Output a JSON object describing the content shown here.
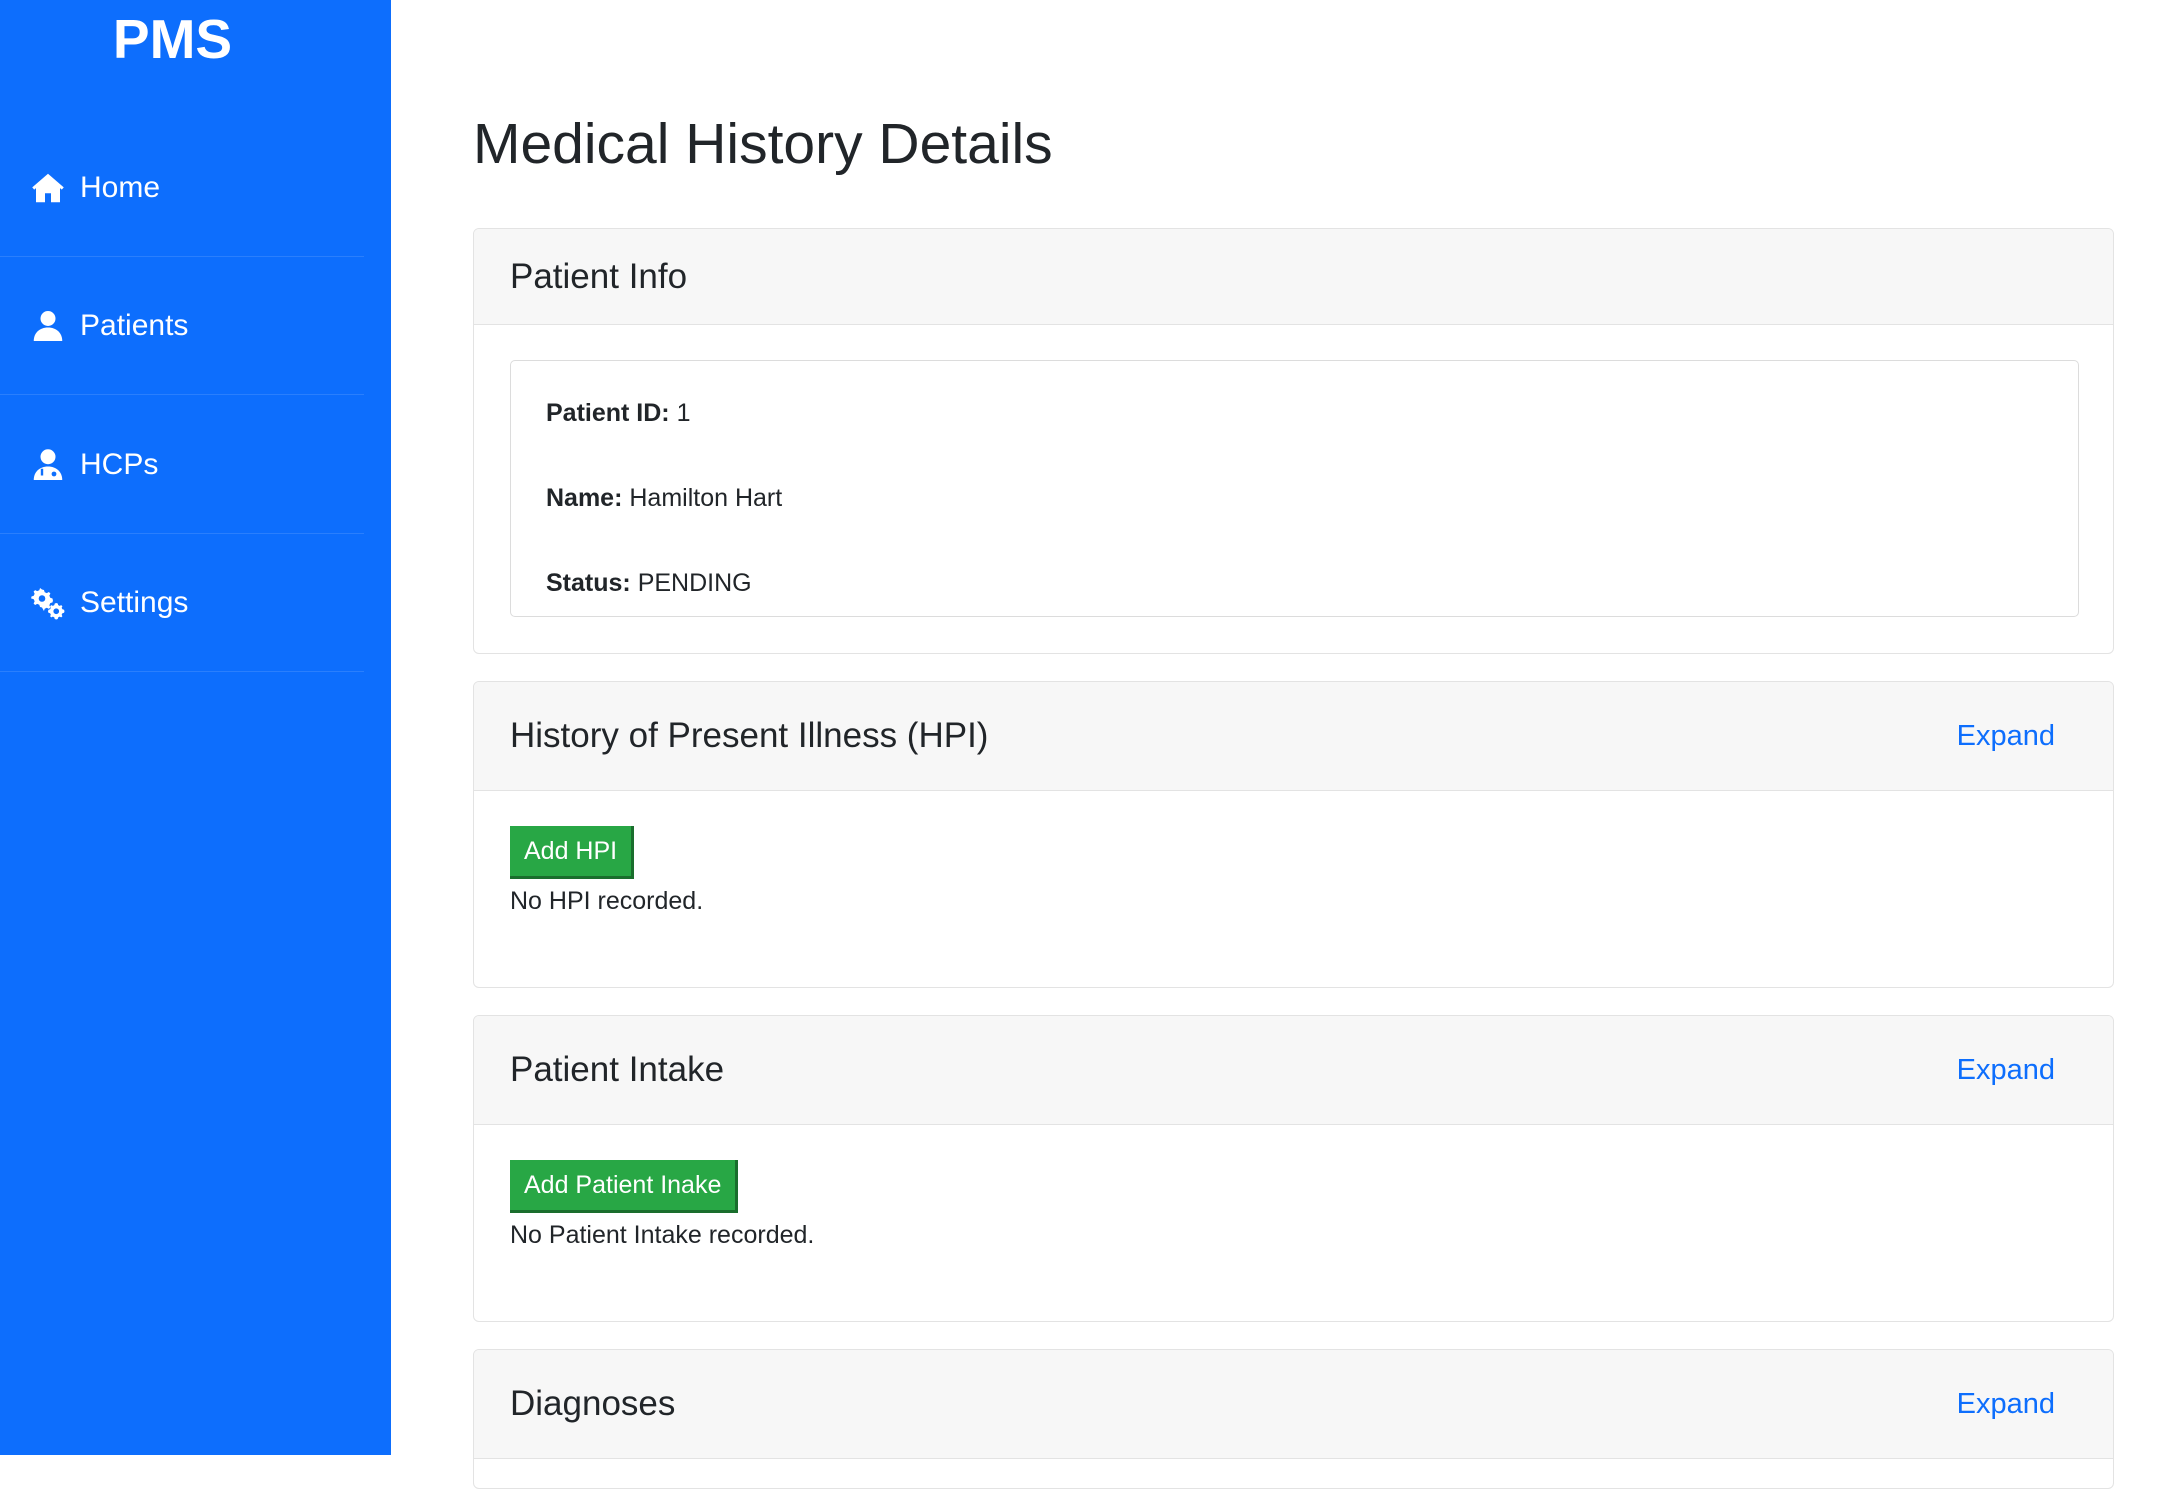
{
  "sidebar": {
    "brand": "PMS",
    "items": [
      {
        "label": "Home",
        "icon": "home-icon"
      },
      {
        "label": "Patients",
        "icon": "user-icon"
      },
      {
        "label": "HCPs",
        "icon": "doctor-icon"
      },
      {
        "label": "Settings",
        "icon": "gears-icon"
      }
    ]
  },
  "main": {
    "title": "Medical History Details",
    "patient_info": {
      "header": "Patient Info",
      "id_label": "Patient ID:",
      "id_value": "1",
      "name_label": "Name:",
      "name_value": "Hamilton Hart",
      "status_label": "Status:",
      "status_value": "PENDING"
    },
    "hpi": {
      "header": "History of Present Illness (HPI)",
      "expand_label": "Expand",
      "add_label": "Add HPI",
      "empty_text": "No HPI recorded."
    },
    "intake": {
      "header": "Patient Intake",
      "expand_label": "Expand",
      "add_label": "Add Patient Inake",
      "empty_text": "No Patient Intake recorded."
    },
    "diagnoses": {
      "header": "Diagnoses",
      "expand_label": "Expand"
    }
  },
  "colors": {
    "sidebar": "#0d6efd",
    "link": "#0d6efd",
    "success": "#28a745",
    "card_header": "#f7f7f7"
  }
}
